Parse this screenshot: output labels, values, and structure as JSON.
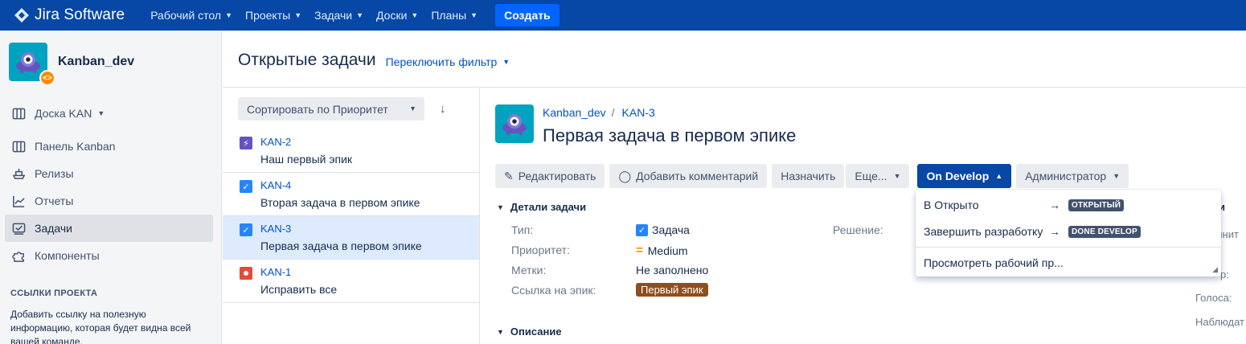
{
  "topbar": {
    "product": "Jira Software",
    "nav": [
      "Рабочий стол",
      "Проекты",
      "Задачи",
      "Доски",
      "Планы"
    ],
    "create": "Создать",
    "bg_color": "#0747a6"
  },
  "sidebar": {
    "project_name": "Kanban_dev",
    "items": [
      {
        "label": "Доска KAN",
        "icon": "board-icon"
      },
      {
        "label": "Панель Kanban",
        "icon": "kanban-icon"
      },
      {
        "label": "Релизы",
        "icon": "ship-icon"
      },
      {
        "label": "Отчеты",
        "icon": "chart-icon"
      },
      {
        "label": "Задачи",
        "icon": "issues-icon"
      },
      {
        "label": "Компоненты",
        "icon": "puzzle-icon"
      }
    ],
    "section_title": "ССЫЛКИ ПРОЕКТА",
    "section_text": "Добавить ссылку на полезную информацию, которая будет видна всей вашей команде."
  },
  "header": {
    "title": "Открытые задачи",
    "switch_filter": "Переключить фильтр"
  },
  "list": {
    "sort_label": "Сортировать по Приоритет",
    "sort_dir": "↓",
    "issues": [
      {
        "key": "KAN-2",
        "summary": "Наш первый эпик",
        "type": "epic",
        "color": "#6554c0"
      },
      {
        "key": "KAN-4",
        "summary": "Вторая задача в первом эпике",
        "type": "task",
        "color": "#4bade8"
      },
      {
        "key": "KAN-3",
        "summary": "Первая задача в первом эпике",
        "type": "task",
        "color": "#4bade8"
      },
      {
        "key": "KAN-1",
        "summary": "Исправить все",
        "type": "bug",
        "color": "#e5493a"
      }
    ]
  },
  "detail": {
    "breadcrumb_project": "Kanban_dev",
    "breadcrumb_key": "KAN-3",
    "title": "Первая задача в первом эпике",
    "buttons": {
      "edit": "Редактировать",
      "comment": "Добавить комментарий",
      "assign": "Назначить",
      "more": "Еще...",
      "status": "On Develop",
      "admin": "Администратор"
    },
    "details_section": "Детали задачи",
    "fields": {
      "type_label": "Тип:",
      "type_value": "Задача",
      "priority_label": "Приоритет:",
      "priority_value": "Medium",
      "labels_label": "Метки:",
      "labels_value": "Не заполнено",
      "epic_label": "Ссылка на эпик:",
      "epic_value": "Первый эпик",
      "resolution_label": "Решение:"
    },
    "right_fragments": [
      "и",
      "олнит",
      "р:",
      "Голоса:",
      "Наблюдат"
    ],
    "description_section": "Описание"
  },
  "status_menu": {
    "items": [
      {
        "label": "В Открыто",
        "arrow": "→",
        "target": "ОТКРЫТЫЙ"
      },
      {
        "label": "Завершить разработку",
        "arrow": "→",
        "target": "DONE DEVELOP"
      }
    ],
    "view_workflow": "Просмотреть рабочий пр..."
  }
}
